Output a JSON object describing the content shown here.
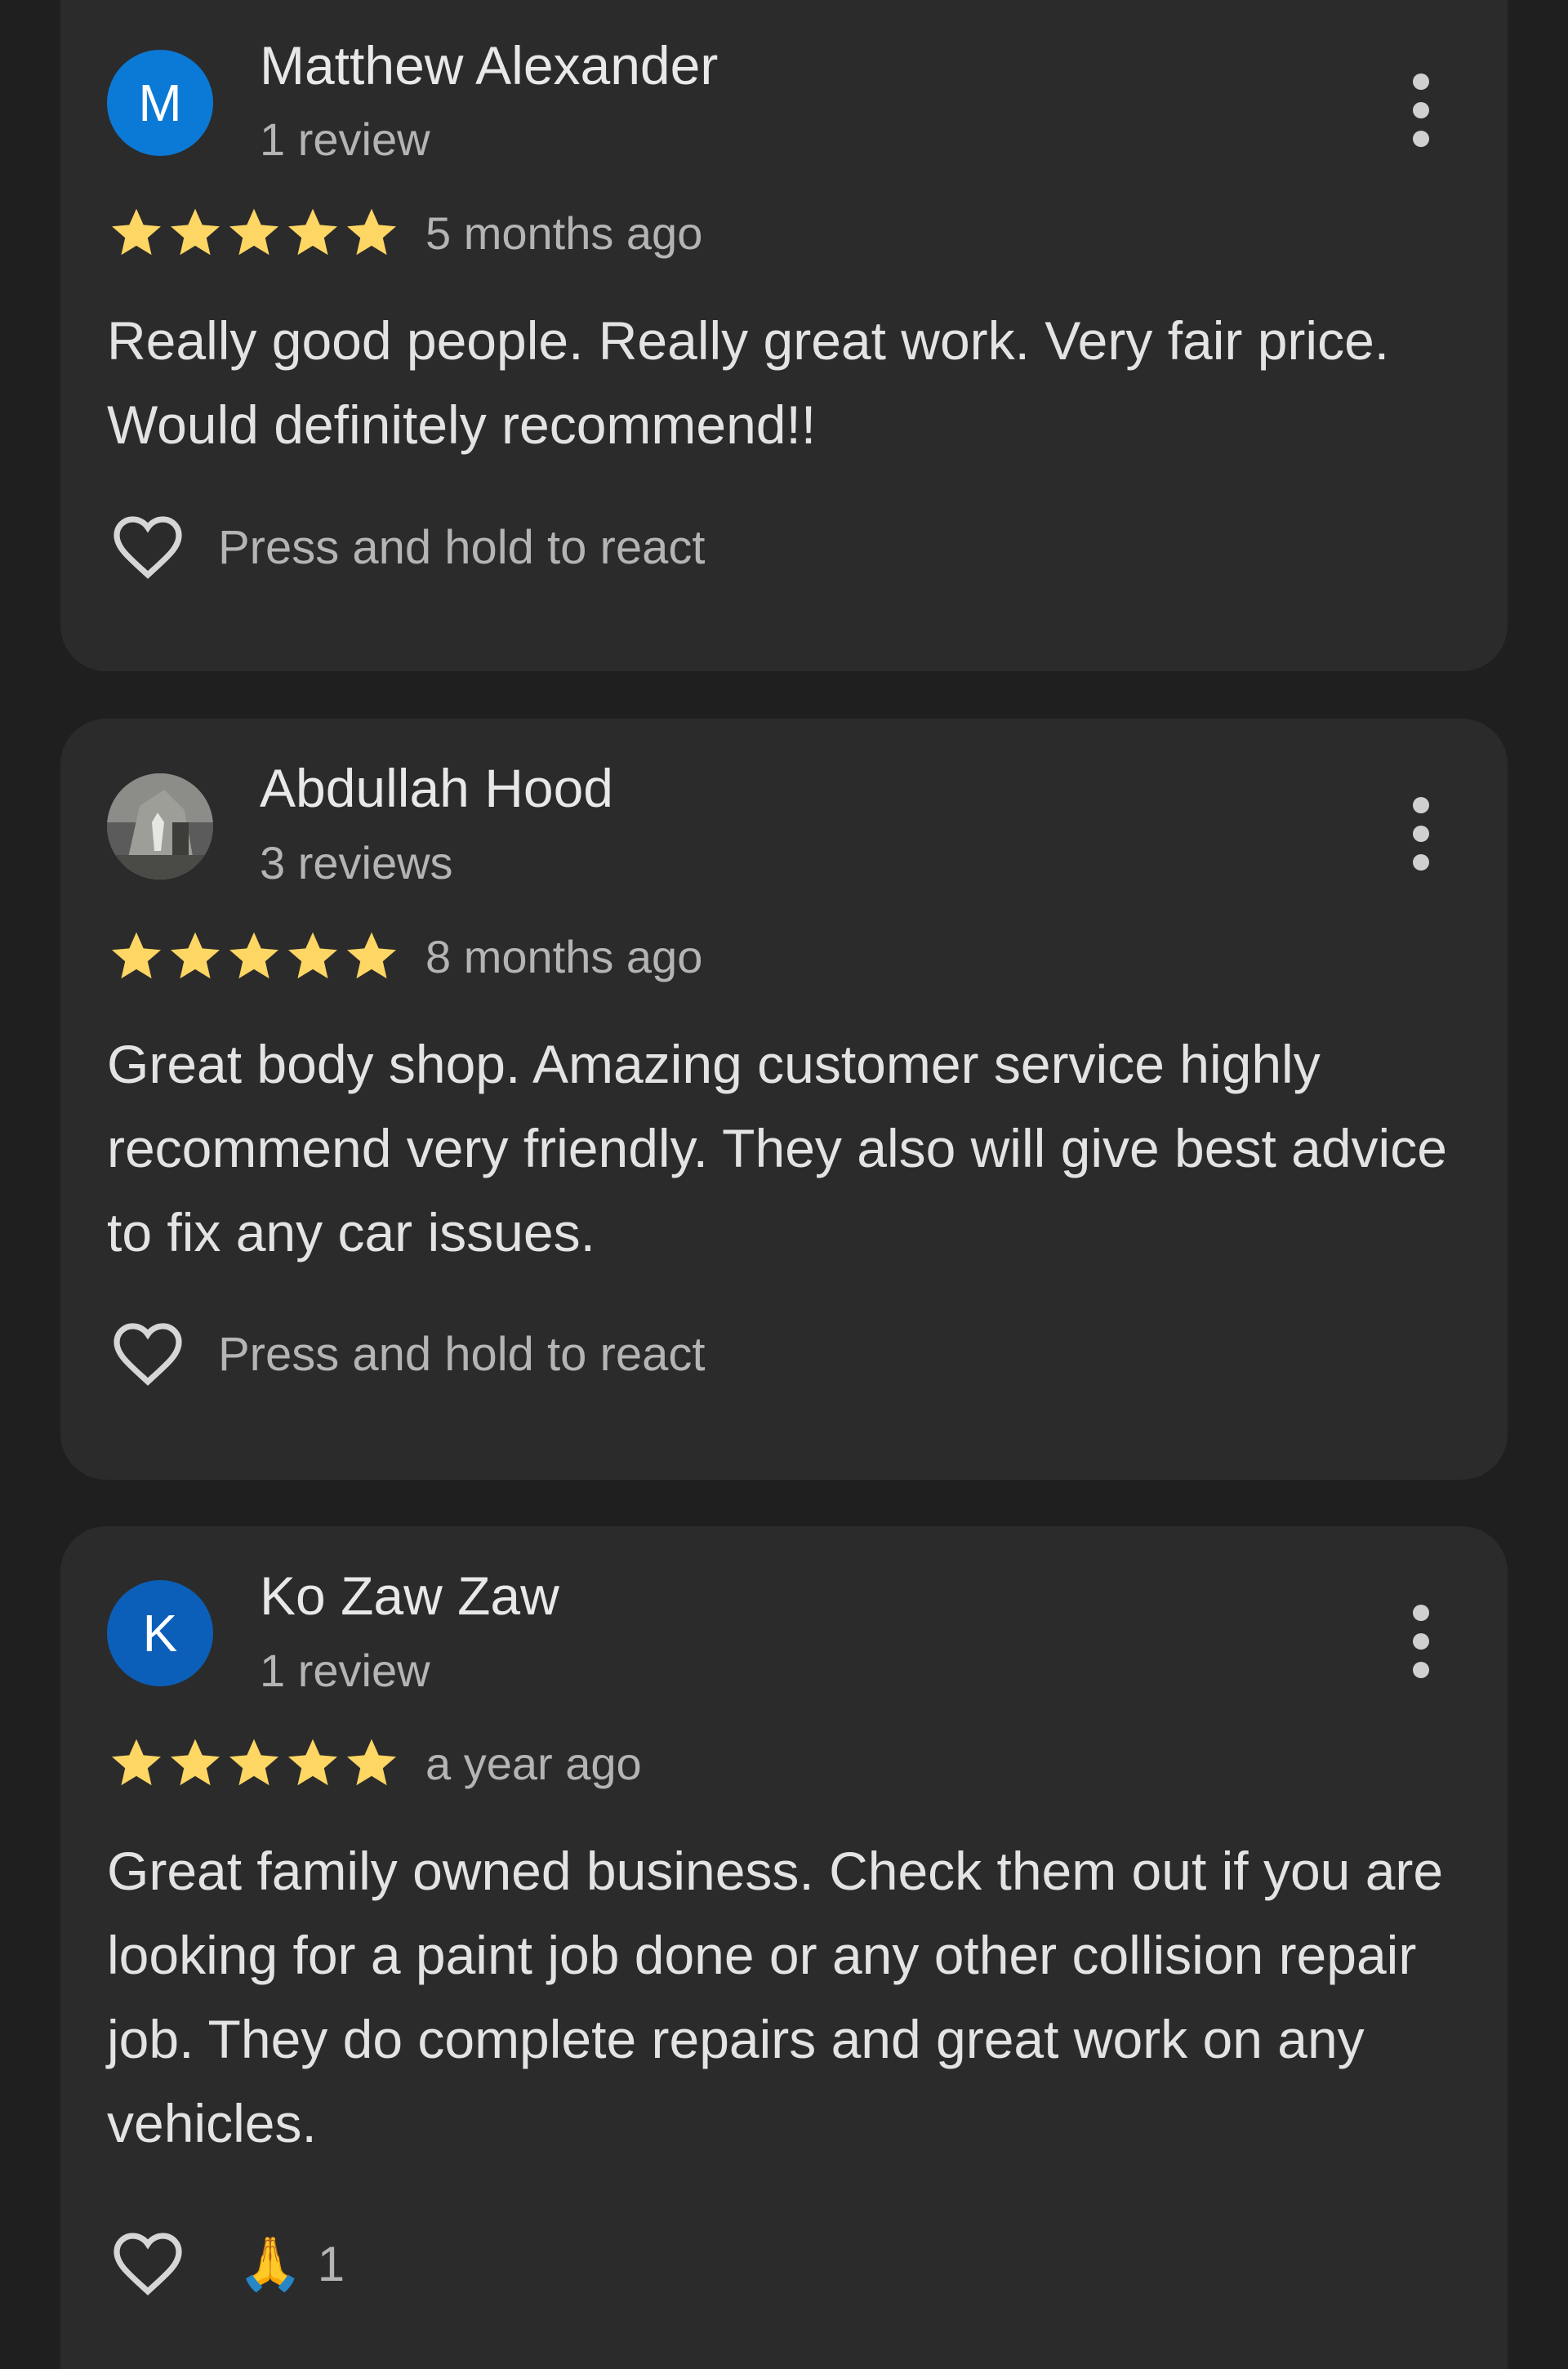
{
  "reviews": [
    {
      "avatar_letter": "M",
      "avatar_color": "#0b7ad6",
      "name": "Matthew Alexander",
      "review_count": "1 review",
      "rating": 5,
      "time_ago": "5 months ago",
      "text": "Really good people. Really great work. Very fair price. Would definitely recommend!!",
      "react_hint": "Press and hold to react"
    },
    {
      "avatar_letter": "",
      "avatar_color": "#6b6b6b",
      "name": "Abdullah Hood",
      "review_count": "3 reviews",
      "rating": 5,
      "time_ago": "8 months ago",
      "text": "Great body shop. Amazing customer service highly recommend very friendly. They also will give best advice to fix any car issues.",
      "react_hint": "Press and hold to react"
    },
    {
      "avatar_letter": "K",
      "avatar_color": "#0b5fb8",
      "name": "Ko Zaw Zaw",
      "review_count": "1 review",
      "rating": 5,
      "time_ago": "a year ago",
      "text": "Great family owned business. Check them out if you are looking for a paint job done or any other collision repair job. They do complete repairs and great work on any vehicles.",
      "reaction_emoji": "🙏",
      "reaction_count": "1"
    }
  ],
  "colors": {
    "background": "#1f1f1f",
    "card": "#2b2b2b",
    "star": "#fdd663",
    "text": "#e3e3e3",
    "muted": "#b4b4b4"
  },
  "icons": {
    "menu": "more-vert-icon",
    "heart": "heart-outline-icon",
    "star": "star-filled-icon"
  }
}
